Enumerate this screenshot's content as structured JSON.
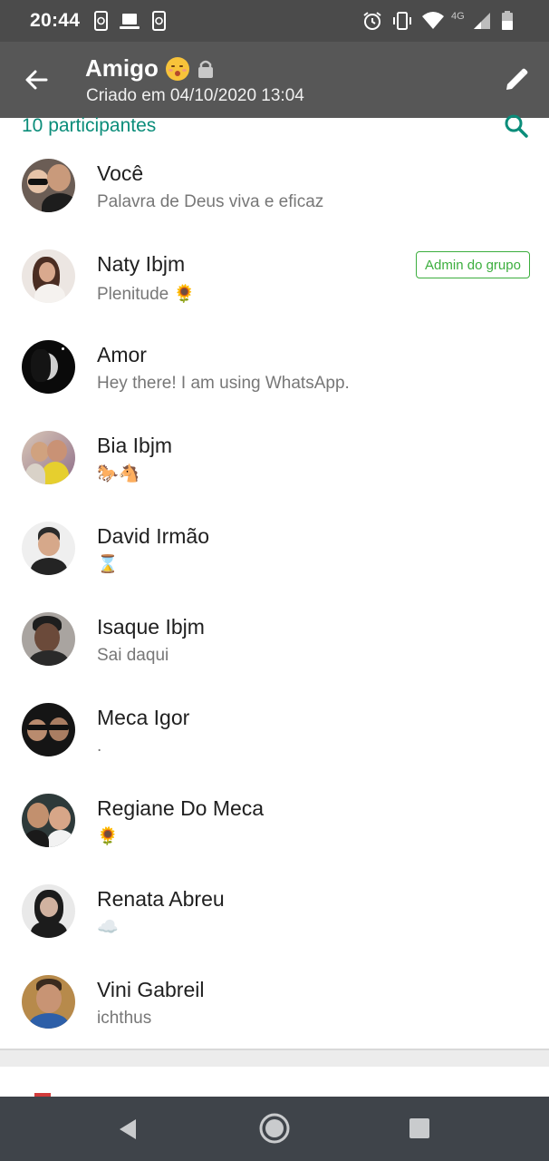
{
  "status_bar": {
    "time": "20:44",
    "network": "4G",
    "icons": [
      "phone-sync-icon",
      "laptop-icon",
      "phone-sync-icon",
      "alarm-icon",
      "vibrate-icon",
      "wifi-icon",
      "signal-icon",
      "battery-icon"
    ]
  },
  "toolbar": {
    "title": "Amigo",
    "title_emoji": "shushing-face-emoji",
    "title_lock": "lock-icon",
    "subtitle": "Criado em 04/10/2020 13:04",
    "back_icon": "arrow-left-icon",
    "edit_icon": "pencil-icon"
  },
  "participants": {
    "count_label": "10 participantes",
    "search_icon": "search-icon",
    "admin_label": "Admin do grupo",
    "items": [
      {
        "name": "Você",
        "status": "Palavra de Deus viva e eficaz"
      },
      {
        "name": "Naty Ibjm",
        "status": "Plenitude 🌻",
        "admin": true
      },
      {
        "name": "Amor",
        "status": "Hey there! I am using WhatsApp."
      },
      {
        "name": "Bia Ibjm",
        "status": "🐎🐴"
      },
      {
        "name": "David Irmão",
        "status": "⌛"
      },
      {
        "name": "Isaque Ibjm",
        "status": "Sai daqui"
      },
      {
        "name": "Meca Igor",
        "status": "."
      },
      {
        "name": "Regiane Do Meca",
        "status": "🌻"
      },
      {
        "name": "Renata Abreu",
        "status": "☁️"
      },
      {
        "name": "Vini Gabreil",
        "status": "ichthus"
      }
    ]
  },
  "nav_bar": {
    "icons": [
      "nav-back-icon",
      "nav-home-icon",
      "nav-recents-icon"
    ]
  },
  "colors": {
    "accent": "#0b8d7a",
    "admin": "#3cae3e",
    "toolbar": "#575757",
    "status_bar": "#4b4b4b",
    "nav_bar": "#3f444a"
  }
}
